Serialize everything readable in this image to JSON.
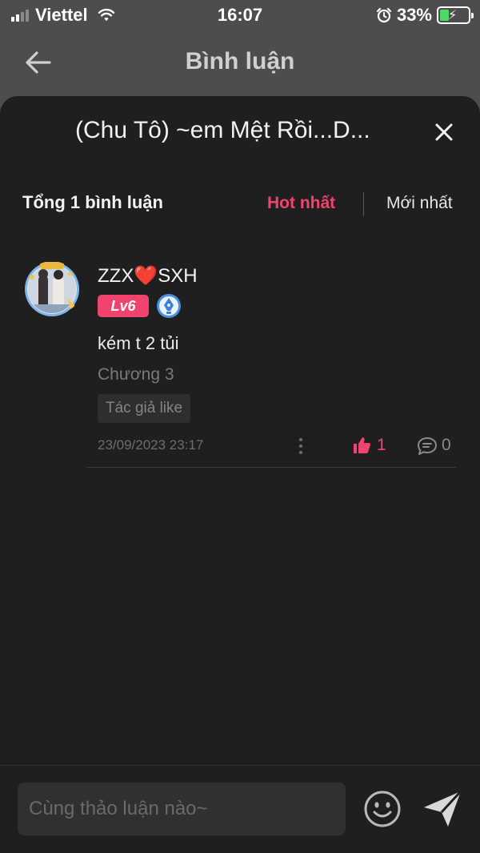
{
  "status_bar": {
    "carrier": "Viettel",
    "time": "16:07",
    "battery_percent": "33%",
    "battery_level": 0.33
  },
  "header": {
    "title": "Bình luận",
    "back_icon": "arrow-left-icon"
  },
  "sheet": {
    "title": "(Chu Tô) ~em Mệt Rồi...D...",
    "close_icon": "close-icon",
    "count_label": "Tổng 1 bình luận",
    "sort": {
      "hot_label": "Hot nhất",
      "new_label": "Mới nhất",
      "active": "hot"
    }
  },
  "comments": [
    {
      "username_prefix": "ZZX",
      "username_heart": "❤️",
      "username_suffix": "SXH",
      "level": "Lv6",
      "text": "kém t 2 tủi",
      "chapter": "Chương 3",
      "tag": "Tác giả like",
      "timestamp": "23/09/2023 23:17",
      "likes": "1",
      "replies": "0"
    }
  ],
  "input": {
    "placeholder": "Cùng thảo luận nào~",
    "value": ""
  },
  "colors": {
    "accent": "#f0436d",
    "sheet_bg": "#1f1f20",
    "header_bg": "#4d4d4f",
    "battery_green": "#4cd964"
  }
}
